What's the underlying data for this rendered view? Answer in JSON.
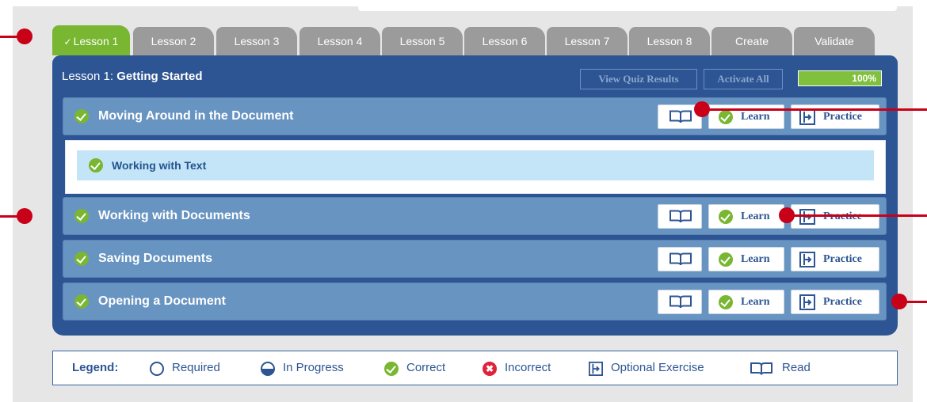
{
  "tabs": [
    {
      "label": "Lesson 1",
      "active": true,
      "check": "✓"
    },
    {
      "label": "Lesson 2"
    },
    {
      "label": "Lesson 3"
    },
    {
      "label": "Lesson 4"
    },
    {
      "label": "Lesson 5"
    },
    {
      "label": "Lesson 6"
    },
    {
      "label": "Lesson 7"
    },
    {
      "label": "Lesson 8"
    },
    {
      "label": "Create"
    },
    {
      "label": "Validate"
    }
  ],
  "header": {
    "lesson_prefix": "Lesson 1: ",
    "lesson_name": "Getting Started",
    "view_quiz_label": "View Quiz Results",
    "activate_all_label": "Activate All",
    "progress_text": "100%",
    "progress_value": 1.0
  },
  "rows": [
    {
      "label": "Moving Around in the Document",
      "learn": "Learn",
      "practice": "Practice"
    },
    {
      "label": "Working with Documents",
      "learn": "Learn",
      "practice": "Practice"
    },
    {
      "label": "Saving Documents",
      "learn": "Learn",
      "practice": "Practice"
    },
    {
      "label": "Opening a Document",
      "learn": "Learn",
      "practice": "Practice"
    }
  ],
  "subrow": {
    "label": "Working with Text"
  },
  "legend": {
    "title": "Legend:",
    "required": "Required",
    "in_progress": "In Progress",
    "correct": "Correct",
    "incorrect": "Incorrect",
    "incorrect_glyph": "✖",
    "optional": "Optional Exercise",
    "read": "Read"
  },
  "colors": {
    "accent": "#2d5593",
    "tab_active": "#79b632",
    "tab_inactive": "#9b9b9b",
    "row": "#6894c2",
    "callout": "#c80018"
  }
}
